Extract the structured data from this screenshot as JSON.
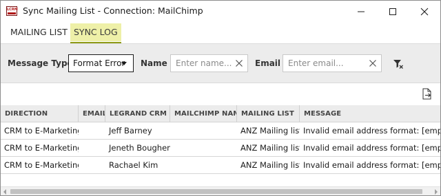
{
  "window": {
    "title": "Sync Mailing List - Connection: MailChimp",
    "icon_text": "LCRM",
    "controls": [
      "minimize-icon",
      "maximize-icon",
      "close-icon"
    ]
  },
  "tabs": [
    {
      "label": "MAILING LIST",
      "active": false
    },
    {
      "label": "SYNC LOG",
      "active": true
    }
  ],
  "filters": {
    "message_type_label": "Message Type",
    "message_type_value": "Format Error",
    "name_label": "Name",
    "name_placeholder": "Enter name...",
    "email_label": "Email",
    "email_placeholder": "Enter email...",
    "clear_filters_icon": "filter-clear-icon"
  },
  "toolbar": {
    "export_icon": "export-icon"
  },
  "grid": {
    "columns": [
      "DIRECTION",
      "EMAIL",
      "LEGRAND CRM NA",
      "MAILCHIMP NAME",
      "MAILING LIST",
      "MESSAGE"
    ],
    "rows": [
      {
        "direction": "CRM to E-Marketing",
        "email": "",
        "crm_name": "Jeff Barney",
        "mailchimp_name": "",
        "mailing_list": "ANZ Mailing list",
        "message": "Invalid email address format: [empty]"
      },
      {
        "direction": "CRM to E-Marketing",
        "email": "",
        "crm_name": "Jeneth Boughen",
        "mailchimp_name": "",
        "mailing_list": "ANZ Mailing list",
        "message": "Invalid email address format: [empty]"
      },
      {
        "direction": "CRM to E-Marketing",
        "email": "",
        "crm_name": "Rachael Kim",
        "mailchimp_name": "",
        "mailing_list": "ANZ Mailing list",
        "message": "Invalid email address format: [empty]"
      }
    ]
  },
  "colors": {
    "active_tab_bg": "#eef0a8",
    "active_tab_underline": "#8e9a14",
    "filter_bar_bg": "#ececec"
  }
}
